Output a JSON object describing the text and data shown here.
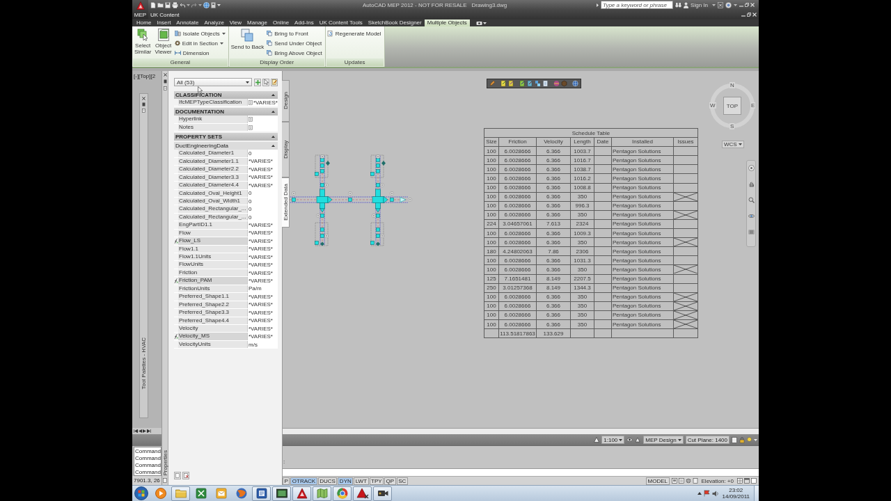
{
  "title_bar": {
    "app_badge": "MEP",
    "workspace": "UK Content",
    "app_title": "AutoCAD MEP 2012 - NOT FOR RESALE",
    "file_name": "Drawing3.dwg",
    "search": {
      "placeholder": "Type a keyword or phrase"
    },
    "sign_in": "Sign In"
  },
  "ribbon": {
    "tabs": [
      {
        "label": "Home",
        "selected": false
      },
      {
        "label": "Insert",
        "selected": false
      },
      {
        "label": "Annotate",
        "selected": false
      },
      {
        "label": "Analyze",
        "selected": false
      },
      {
        "label": "View",
        "selected": false
      },
      {
        "label": "Manage",
        "selected": false
      },
      {
        "label": "Online",
        "selected": false
      },
      {
        "label": "Add-Ins",
        "selected": false
      },
      {
        "label": "UK Content Tools",
        "selected": false
      },
      {
        "label": "SketchBook Designer",
        "selected": false
      },
      {
        "label": "Multiple Objects",
        "selected": true
      }
    ],
    "panels": [
      {
        "title": "General",
        "buttons": [
          {
            "kind": "large",
            "lines": [
              "Select",
              "Similar"
            ]
          },
          {
            "kind": "large",
            "lines": [
              "Object",
              "Viewer"
            ]
          },
          {
            "kind": "small",
            "label": "Isolate Objects",
            "dropdown": true
          },
          {
            "kind": "small",
            "label": "Edit in Section",
            "dropdown": true
          },
          {
            "kind": "small",
            "label": "Dimension",
            "dropdown": false
          }
        ]
      },
      {
        "title": "Display Order",
        "buttons": [
          {
            "kind": "large",
            "lines": [
              "Send to Back"
            ]
          },
          {
            "kind": "small",
            "label": "Bring to Front",
            "dropdown": false
          },
          {
            "kind": "small",
            "label": "Send Under Object",
            "dropdown": false
          },
          {
            "kind": "small",
            "label": "Bring Above Object",
            "dropdown": false
          }
        ]
      },
      {
        "title": "Updates",
        "buttons": [
          {
            "kind": "small",
            "label": "Regenerate Model",
            "dropdown": false
          }
        ]
      }
    ]
  },
  "viewport_label": "[-][Top][2",
  "tool_palette": {
    "title": "Tool Palettes - HVAC"
  },
  "properties": {
    "title": "Properties",
    "filter": "All (53)",
    "tabs": [
      {
        "label": "Design",
        "selected": false
      },
      {
        "label": "Display",
        "selected": false
      },
      {
        "label": "Extended Data",
        "selected": true
      }
    ],
    "sections": [
      {
        "title": "CLASSIFICATION",
        "expanded": true,
        "rows": [
          {
            "name": "IfcMEPTypeClassification",
            "kind": "picker",
            "value": "*VARIES*",
            "formula": false
          }
        ]
      },
      {
        "title": "DOCUMENTATION",
        "expanded": true,
        "rows": [
          {
            "name": "Hyperlink",
            "kind": "picker",
            "formula": false
          },
          {
            "name": "Notes",
            "kind": "picker",
            "formula": false
          }
        ]
      },
      {
        "title": "PROPERTY SETS",
        "expanded": true,
        "groups": [
          {
            "title": "DuctEngineeringData",
            "expanded": true,
            "rows": [
              {
                "name": "Calculated_Diameter1",
                "kind": "text",
                "value": "0",
                "formula": false
              },
              {
                "name": "Calculated_Diameter1.1",
                "kind": "text",
                "value": "*VARIES*",
                "formula": false
              },
              {
                "name": "Calculated_Diameter2.2",
                "kind": "text",
                "value": "*VARIES*",
                "formula": false
              },
              {
                "name": "Calculated_Diameter3.3",
                "kind": "text",
                "value": "*VARIES*",
                "formula": false
              },
              {
                "name": "Calculated_Diameter4.4",
                "kind": "text",
                "value": "*VARIES*",
                "formula": false
              },
              {
                "name": "Calculated_Oval_Height1",
                "kind": "text",
                "value": "0",
                "formula": false
              },
              {
                "name": "Calculated_Oval_Width1",
                "kind": "text",
                "value": "0",
                "formula": false
              },
              {
                "name": "Calculated_Rectangular_...",
                "kind": "text",
                "value": "0",
                "formula": false
              },
              {
                "name": "Calculated_Rectangular_...",
                "kind": "text",
                "value": "0",
                "formula": false
              },
              {
                "name": "EngPartID1.1",
                "kind": "text",
                "value": "*VARIES*",
                "formula": false
              },
              {
                "name": "Flow",
                "kind": "text",
                "value": "*VARIES*",
                "formula": false
              },
              {
                "name": "Flow_LS",
                "kind": "text",
                "value": "*VARIES*",
                "formula": true
              },
              {
                "name": "Flow1.1",
                "kind": "text",
                "value": "*VARIES*",
                "formula": false
              },
              {
                "name": "Flow1.1Units",
                "kind": "text",
                "value": "*VARIES*",
                "formula": false
              },
              {
                "name": "FlowUnits",
                "kind": "text",
                "value": "*VARIES*",
                "formula": false
              },
              {
                "name": "Friction",
                "kind": "text",
                "value": "*VARIES*",
                "formula": false
              },
              {
                "name": "Friction_PAM",
                "kind": "text",
                "value": "*VARIES*",
                "formula": true
              },
              {
                "name": "FrictionUnits",
                "kind": "text",
                "value": "Pa/m",
                "formula": false
              },
              {
                "name": "Preferred_Shape1.1",
                "kind": "text",
                "value": "*VARIES*",
                "formula": false
              },
              {
                "name": "Preferred_Shape2.2",
                "kind": "text",
                "value": "*VARIES*",
                "formula": false
              },
              {
                "name": "Preferred_Shape3.3",
                "kind": "text",
                "value": "*VARIES*",
                "formula": false
              },
              {
                "name": "Preferred_Shape4.4",
                "kind": "text",
                "value": "*VARIES*",
                "formula": false
              },
              {
                "name": "Velocity",
                "kind": "text",
                "value": "*VARIES*",
                "formula": false
              },
              {
                "name": "Velocity_MS",
                "kind": "text",
                "value": "*VARIES*",
                "formula": true
              },
              {
                "name": "VelocityUnits",
                "kind": "text",
                "value": "m/s",
                "formula": false
              }
            ]
          }
        ]
      }
    ]
  },
  "view_cube": {
    "face": "TOP",
    "north": "N",
    "east": "E",
    "south": "S",
    "west": "W",
    "ucs": "WCS"
  },
  "schedule_table": {
    "title": "Schedule Table",
    "columns": [
      "Size",
      "Friction",
      "Velocity",
      "Length",
      "Date",
      "Installed",
      "Issues"
    ],
    "rows": [
      {
        "size": "100",
        "friction": "6.0028666",
        "velocity": "6.366",
        "length": "1003.7",
        "installed": "Pentagon Solutions",
        "crossed": false
      },
      {
        "size": "100",
        "friction": "6.0028666",
        "velocity": "6.366",
        "length": "1016.7",
        "installed": "Pentagon Solutions",
        "crossed": false
      },
      {
        "size": "100",
        "friction": "6.0028666",
        "velocity": "6.366",
        "length": "1038.7",
        "installed": "Pentagon Solutions",
        "crossed": false
      },
      {
        "size": "100",
        "friction": "6.0028666",
        "velocity": "6.366",
        "length": "1016.2",
        "installed": "Pentagon Solutions",
        "crossed": false
      },
      {
        "size": "100",
        "friction": "6.0028666",
        "velocity": "6.366",
        "length": "1008.8",
        "installed": "Pentagon Solutions",
        "crossed": false
      },
      {
        "size": "100",
        "friction": "6.0028666",
        "velocity": "6.366",
        "length": "350",
        "installed": "Pentagon Solutions",
        "crossed": true
      },
      {
        "size": "100",
        "friction": "6.0028666",
        "velocity": "6.366",
        "length": "996.3",
        "installed": "Pentagon Solutions",
        "crossed": false
      },
      {
        "size": "100",
        "friction": "6.0028666",
        "velocity": "6.366",
        "length": "350",
        "installed": "Pentagon Solutions",
        "crossed": true
      },
      {
        "size": "224",
        "friction": "3.04657061",
        "velocity": "7.613",
        "length": "2324",
        "installed": "Pentagon Solutions",
        "crossed": false
      },
      {
        "size": "100",
        "friction": "6.0028666",
        "velocity": "6.366",
        "length": "1009.3",
        "installed": "Pentagon Solutions",
        "crossed": false
      },
      {
        "size": "100",
        "friction": "6.0028666",
        "velocity": "6.366",
        "length": "350",
        "installed": "Pentagon Solutions",
        "crossed": true
      },
      {
        "size": "180",
        "friction": "4.24802063",
        "velocity": "7.86",
        "length": "2306",
        "installed": "Pentagon Solutions",
        "crossed": false
      },
      {
        "size": "100",
        "friction": "6.0028666",
        "velocity": "6.366",
        "length": "1031.3",
        "installed": "Pentagon Solutions",
        "crossed": false
      },
      {
        "size": "100",
        "friction": "6.0028666",
        "velocity": "6.366",
        "length": "350",
        "installed": "Pentagon Solutions",
        "crossed": true
      },
      {
        "size": "125",
        "friction": "7.1651481",
        "velocity": "8.149",
        "length": "2207.5",
        "installed": "Pentagon Solutions",
        "crossed": false
      },
      {
        "size": "250",
        "friction": "3.01257368",
        "velocity": "8.149",
        "length": "1344.3",
        "installed": "Pentagon Solutions",
        "crossed": false
      },
      {
        "size": "100",
        "friction": "6.0028666",
        "velocity": "6.366",
        "length": "350",
        "installed": "Pentagon Solutions",
        "crossed": true
      },
      {
        "size": "100",
        "friction": "6.0028666",
        "velocity": "6.366",
        "length": "350",
        "installed": "Pentagon Solutions",
        "crossed": true
      },
      {
        "size": "100",
        "friction": "6.0028666",
        "velocity": "6.366",
        "length": "350",
        "installed": "Pentagon Solutions",
        "crossed": true
      },
      {
        "size": "100",
        "friction": "6.0028666",
        "velocity": "6.366",
        "length": "350",
        "installed": "Pentagon Solutions",
        "crossed": true
      }
    ],
    "totals": {
      "friction": "113.51817863",
      "velocity": "133.629"
    }
  },
  "drawing_status": {
    "annotation_scale": "1:100",
    "display_configuration": "MEP Design",
    "cut_plane": "Cut Plane: 1400"
  },
  "command_line": {
    "history": [
      "Command",
      "Command",
      "Command",
      "Command"
    ],
    "prompt_tail": ":"
  },
  "coordinates": "7901.3, 26",
  "status_bar": {
    "toggles": [
      {
        "label": "P",
        "on": false
      },
      {
        "label": "OTRACK",
        "on": true
      },
      {
        "label": "DUCS",
        "on": false
      },
      {
        "label": "DYN",
        "on": true
      },
      {
        "label": "LWT",
        "on": false
      },
      {
        "label": "TPY",
        "on": false
      },
      {
        "label": "QP",
        "on": false
      },
      {
        "label": "SC",
        "on": false
      }
    ],
    "space": "MODEL",
    "elevation": "Elevation: +0"
  },
  "taskbar": {
    "apps": [
      {
        "open": false
      },
      {
        "open": true
      },
      {
        "open": false
      },
      {
        "open": false
      },
      {
        "open": false
      },
      {
        "open": true
      },
      {
        "open": true
      },
      {
        "open": true
      },
      {
        "open": true
      },
      {
        "open": true
      },
      {
        "open": true
      },
      {
        "open": true
      }
    ],
    "clock": {
      "time": "23:02",
      "date": "14/09/2011"
    }
  }
}
